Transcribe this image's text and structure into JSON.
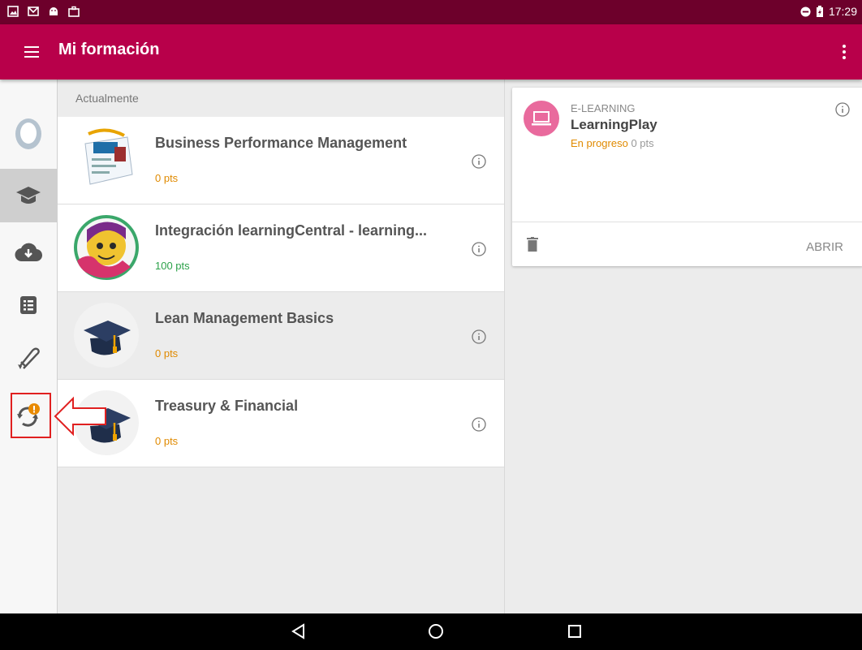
{
  "status_bar": {
    "time": "17:29",
    "icons": [
      "image-icon",
      "gmail-icon",
      "android-icon",
      "briefcase-icon"
    ],
    "right_icons": [
      "do-not-disturb-icon",
      "battery-charging-icon"
    ]
  },
  "app_bar": {
    "title": "Mi formación",
    "color": "#b8004a",
    "dark_color": "#6d002b"
  },
  "rail": {
    "items": [
      {
        "icon": "profile-avatar-icon",
        "active": false
      },
      {
        "icon": "graduation-cap-icon",
        "active": true
      },
      {
        "icon": "cloud-download-icon",
        "active": false
      },
      {
        "icon": "list-document-icon",
        "active": false
      },
      {
        "icon": "diploma-icon",
        "active": false
      },
      {
        "icon": "sync-warning-icon",
        "active": false
      }
    ]
  },
  "list": {
    "section_label": "Actualmente",
    "items": [
      {
        "title": "Business Performance Management",
        "points": "0 pts",
        "points_color": "#e08a00"
      },
      {
        "title": "Integración learningCentral - learning...",
        "points": "100 pts",
        "points_color": "#2ca24a"
      },
      {
        "title": "Lean Management Basics",
        "points": "0 pts",
        "points_color": "#e08a00"
      },
      {
        "title": "Treasury & Financial",
        "points": "0 pts",
        "points_color": "#e08a00"
      }
    ]
  },
  "detail": {
    "kind": "E-LEARNING",
    "title": "LearningPlay",
    "status": "En progreso",
    "status_color": "#e08a00",
    "points": "0 pts",
    "open_label": "ABRIR"
  }
}
